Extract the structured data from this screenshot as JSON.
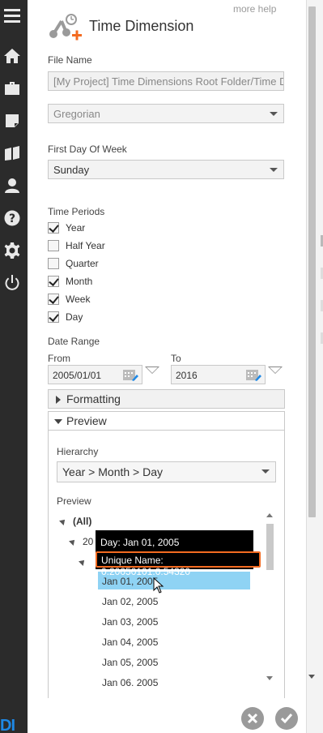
{
  "panel": {
    "more_help": "more help",
    "title": "Time Dimension"
  },
  "file_name": {
    "label": "File Name",
    "value": "[My Project] Time Dimensions Root Folder/Time Dime"
  },
  "calendar": {
    "value": "Gregorian"
  },
  "first_day_of_week": {
    "label": "First Day Of Week",
    "value": "Sunday"
  },
  "time_periods": {
    "label": "Time Periods",
    "items": [
      {
        "label": "Year",
        "checked": true
      },
      {
        "label": "Half Year",
        "checked": false
      },
      {
        "label": "Quarter",
        "checked": false
      },
      {
        "label": "Month",
        "checked": true
      },
      {
        "label": "Week",
        "checked": true
      },
      {
        "label": "Day",
        "checked": true
      }
    ]
  },
  "date_range": {
    "label": "Date Range",
    "from_label": "From",
    "from_value": "2005/01/01",
    "to_label": "To",
    "to_value": "2016"
  },
  "sections": {
    "formatting": "Formatting",
    "preview": "Preview"
  },
  "hierarchy": {
    "label": "Hierarchy",
    "value": "Year > Month > Day"
  },
  "preview_tree": {
    "label": "Preview",
    "root": "(All)",
    "year_partial": "20",
    "days": [
      "Jan 01, 2005",
      "Jan 02, 2005",
      "Jan 03, 2005",
      "Jan 04, 2005",
      "Jan 05, 2005",
      "Jan 06, 2005"
    ],
    "selected_index": 0
  },
  "tooltip": {
    "line1": "Day: Jan 01, 2005",
    "line2": "Unique Name: 0.20050101.0.54320"
  },
  "colors": {
    "sidebar": "#2b2b2b",
    "accent_orange": "#f36b21",
    "selected_row": "#8fd3f4"
  },
  "icons": [
    "menu-icon",
    "home-icon",
    "briefcase-icon",
    "note-icon",
    "book-icon",
    "user-icon",
    "help-icon",
    "gear-icon",
    "power-icon",
    "close-icon",
    "check-icon"
  ]
}
